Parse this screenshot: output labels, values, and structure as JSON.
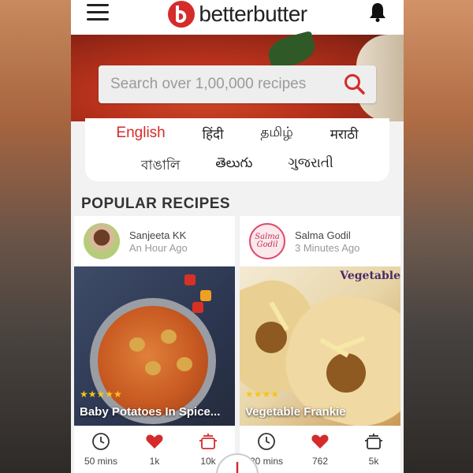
{
  "app": {
    "logo_text": "betterbutter",
    "accent": "#d52b2b"
  },
  "search": {
    "placeholder": "Search over 1,00,000 recipes"
  },
  "languages": {
    "row1": [
      "English",
      "हिंदी",
      "தமிழ்",
      "मराठी"
    ],
    "row2": [
      "বাঙালি",
      "తెలుగు",
      "ગુજરાતી"
    ],
    "active": "English"
  },
  "section": {
    "title": "POPULAR RECIPES"
  },
  "recipes": [
    {
      "author": "Sanjeeta KK",
      "time": "An Hour Ago",
      "title": "Baby Potatoes In Spice...",
      "rating": 5,
      "duration": "50 mins",
      "likes": "1k",
      "cooked": "10k"
    },
    {
      "author": "Salma Godil",
      "avatar_text": "Salma Godil",
      "time": "3 Minutes Ago",
      "image_tag": "Vegetable",
      "title": "Vegetable Frankie",
      "rating": 4,
      "duration": "20 mins",
      "likes": "762",
      "cooked": "5k"
    }
  ]
}
